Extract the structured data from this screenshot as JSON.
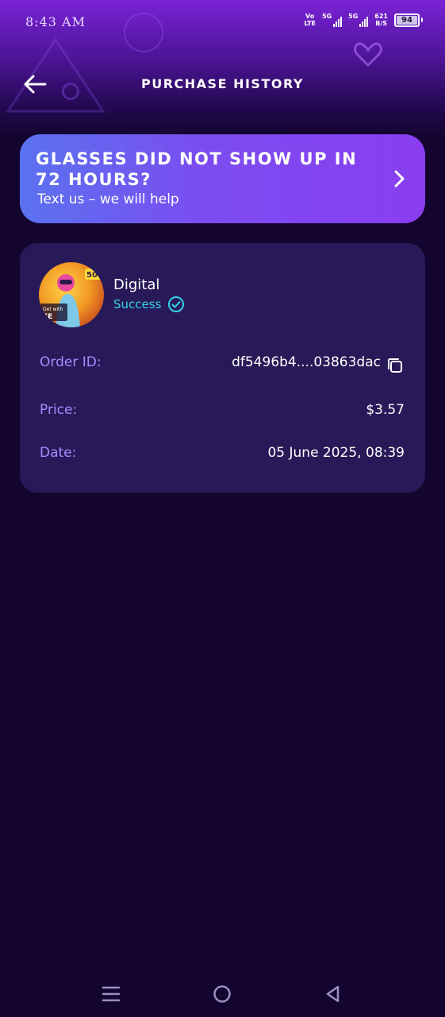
{
  "status_bar": {
    "time": "8:43 AM",
    "volte_top": "Vo",
    "volte_bottom": "LTE",
    "sim1_type": "5G",
    "sim2_type": "5G",
    "net_speed_value": "621",
    "net_speed_unit": "B/S",
    "battery": "94"
  },
  "header": {
    "title": "PURCHASE HISTORY",
    "back_icon": "arrow-left-icon"
  },
  "banner": {
    "title": "GLASSES DID NOT SHOW UP IN 72 HOURS?",
    "subtitle": "Text us – we will help",
    "icon": "chevron-right-icon",
    "gradient_start": "#5a72f0",
    "gradient_end": "#8a3df0"
  },
  "order": {
    "product_name": "Digital",
    "status": "Success",
    "status_color": "#35d2e6",
    "avatar_text_badge": "50",
    "avatar_text_caption": "Get with",
    "avatar_text_brand": "EE",
    "rows": {
      "order_id": {
        "label": "Order ID:",
        "value": "df5496b4....03863dac"
      },
      "price": {
        "label": "Price:",
        "value": "$3.57"
      },
      "date": {
        "label": "Date:",
        "value": "05 June 2025, 08:39"
      }
    }
  },
  "nav": {
    "recents_icon": "menu-icon",
    "home_icon": "circle-home-icon",
    "back_icon": "triangle-back-icon"
  },
  "colors": {
    "background": "#140530",
    "card": "#281a58",
    "label": "#a58cff",
    "accent": "#35d2e6"
  }
}
